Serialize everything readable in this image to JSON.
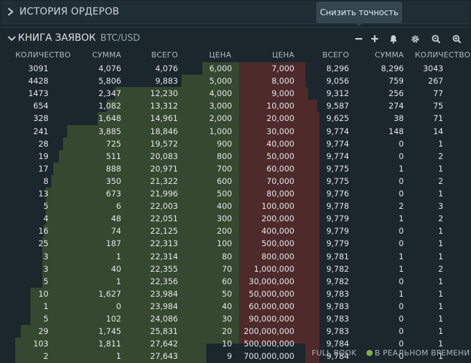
{
  "history": {
    "title": "ИСТОРИЯ ОРДЕРОВ"
  },
  "tooltip": {
    "text": "Снизить точность"
  },
  "book": {
    "title": "КНИГА ЗАЯВОК",
    "pair": "BTC/USD"
  },
  "toolbar": {
    "icons": [
      "minus-icon",
      "plus-icon",
      "bell-icon",
      "gear-icon",
      "zoom-out-icon",
      "zoom-in-icon"
    ]
  },
  "headers": {
    "bid_qty": "КОЛИЧЕСТВО",
    "bid_sum": "СУММА",
    "bid_total": "ВСЕГО",
    "bid_price": "ЦЕНА",
    "ask_price": "ЦЕНА",
    "ask_total": "ВСЕГО",
    "ask_sum": "СУММА",
    "ask_qty": "КОЛИЧЕСТВО"
  },
  "rows": [
    {
      "bq": "3091",
      "bs": "4,076",
      "bt": "4,076",
      "bp": "6,000",
      "ap": "7,000",
      "at": "8,296",
      "as": "8,296",
      "aq": "3043",
      "bd": 0.02,
      "ad": 0.63
    },
    {
      "bq": "4428",
      "bs": "5,806",
      "bt": "9,883",
      "bp": "5,000",
      "ap": "8,000",
      "at": "9,056",
      "as": "759",
      "aq": "267",
      "bd": 0.13,
      "ad": 0.71
    },
    {
      "bq": "1473",
      "bs": "2,347",
      "bt": "12,230",
      "bp": "4,000",
      "ap": "9,000",
      "at": "9,312",
      "as": "256",
      "aq": "77",
      "bd": 0.48,
      "ad": 0.75
    },
    {
      "bq": "654",
      "bs": "1,082",
      "bt": "13,312",
      "bp": "3,000",
      "ap": "10,000",
      "at": "9,587",
      "as": "274",
      "aq": "75",
      "bd": 0.52,
      "ad": 0.81
    },
    {
      "bq": "328",
      "bs": "1,648",
      "bt": "14,961",
      "bp": "2,000",
      "ap": "20,000",
      "at": "9,625",
      "as": "38",
      "aq": "71",
      "bd": 0.57,
      "ad": 0.82
    },
    {
      "bq": "241",
      "bs": "3,885",
      "bt": "18,846",
      "bp": "1,000",
      "ap": "30,000",
      "at": "9,774",
      "as": "148",
      "aq": "14",
      "bd": 0.73,
      "ad": 0.86
    },
    {
      "bq": "28",
      "bs": "725",
      "bt": "19,572",
      "bp": "900",
      "ap": "40,000",
      "at": "9,774",
      "as": "0",
      "aq": "1",
      "bd": 0.75,
      "ad": 0.86
    },
    {
      "bq": "19",
      "bs": "511",
      "bt": "20,083",
      "bp": "800",
      "ap": "50,000",
      "at": "9,774",
      "as": "0",
      "aq": "2",
      "bd": 0.77,
      "ad": 0.86
    },
    {
      "bq": "17",
      "bs": "888",
      "bt": "20,971",
      "bp": "700",
      "ap": "60,000",
      "at": "9,775",
      "as": "1",
      "aq": "1",
      "bd": 0.8,
      "ad": 0.86
    },
    {
      "bq": "8",
      "bs": "350",
      "bt": "21,322",
      "bp": "600",
      "ap": "70,000",
      "at": "9,775",
      "as": "0",
      "aq": "2",
      "bd": 0.81,
      "ad": 0.86
    },
    {
      "bq": "13",
      "bs": "673",
      "bt": "21,996",
      "bp": "500",
      "ap": "80,000",
      "at": "9,776",
      "as": "0",
      "aq": "1",
      "bd": 0.84,
      "ad": 0.86
    },
    {
      "bq": "5",
      "bs": "6",
      "bt": "22,003",
      "bp": "400",
      "ap": "100,000",
      "at": "9,778",
      "as": "2",
      "aq": "3",
      "bd": 0.84,
      "ad": 0.86
    },
    {
      "bq": "4",
      "bs": "48",
      "bt": "22,051",
      "bp": "300",
      "ap": "200,000",
      "at": "9,779",
      "as": "1",
      "aq": "2",
      "bd": 0.84,
      "ad": 0.86
    },
    {
      "bq": "16",
      "bs": "74",
      "bt": "22,125",
      "bp": "200",
      "ap": "400,000",
      "at": "9,779",
      "as": "0",
      "aq": "1",
      "bd": 0.85,
      "ad": 0.86
    },
    {
      "bq": "25",
      "bs": "187",
      "bt": "22,313",
      "bp": "100",
      "ap": "500,000",
      "at": "9,779",
      "as": "0",
      "aq": "1",
      "bd": 0.86,
      "ad": 0.86
    },
    {
      "bq": "3",
      "bs": "1",
      "bt": "22,314",
      "bp": "80",
      "ap": "800,000",
      "at": "9,781",
      "as": "1",
      "aq": "1",
      "bd": 0.86,
      "ad": 0.86
    },
    {
      "bq": "3",
      "bs": "40",
      "bt": "22,355",
      "bp": "70",
      "ap": "1,000,000",
      "at": "9,782",
      "as": "1",
      "aq": "2",
      "bd": 0.86,
      "ad": 0.86
    },
    {
      "bq": "5",
      "bs": "1",
      "bt": "22,356",
      "bp": "60",
      "ap": "30,000,000",
      "at": "9,782",
      "as": "0",
      "aq": "1",
      "bd": 0.86,
      "ad": 0.86
    },
    {
      "bq": "10",
      "bs": "1,627",
      "bt": "23,984",
      "bp": "50",
      "ap": "50,000,000",
      "at": "9,783",
      "as": "1",
      "aq": "1",
      "bd": 0.92,
      "ad": 0.86
    },
    {
      "bq": "1",
      "bs": "0",
      "bt": "23,984",
      "bp": "40",
      "ap": "60,000,000",
      "at": "9,783",
      "as": "0",
      "aq": "1",
      "bd": 0.92,
      "ad": 0.86
    },
    {
      "bq": "5",
      "bs": "102",
      "bt": "24,086",
      "bp": "30",
      "ap": "90,000,000",
      "at": "9,783",
      "as": "0",
      "aq": "1",
      "bd": 0.92,
      "ad": 0.86
    },
    {
      "bq": "29",
      "bs": "1,745",
      "bt": "25,831",
      "bp": "20",
      "ap": "200,000,000",
      "at": "9,783",
      "as": "0",
      "aq": "1",
      "bd": 0.97,
      "ad": 0.86
    },
    {
      "bq": "103",
      "bs": "1,811",
      "bt": "27,642",
      "bp": "10",
      "ap": "500,000,000",
      "at": "9,784",
      "as": "0",
      "aq": "1",
      "bd": 1.0,
      "ad": 0.86
    },
    {
      "bq": "2",
      "bs": "1",
      "bt": "27,643",
      "bp": "9",
      "ap": "700,000,000",
      "at": "9,784",
      "as": "0",
      "aq": "1",
      "bd": 1.0,
      "ad": 0.86
    }
  ],
  "footer": {
    "full_book": "FULL BOOK",
    "realtime": "В РЕАЛЬНОМ ВРЕМЕНИ",
    "realtime_color": "#7db249"
  }
}
